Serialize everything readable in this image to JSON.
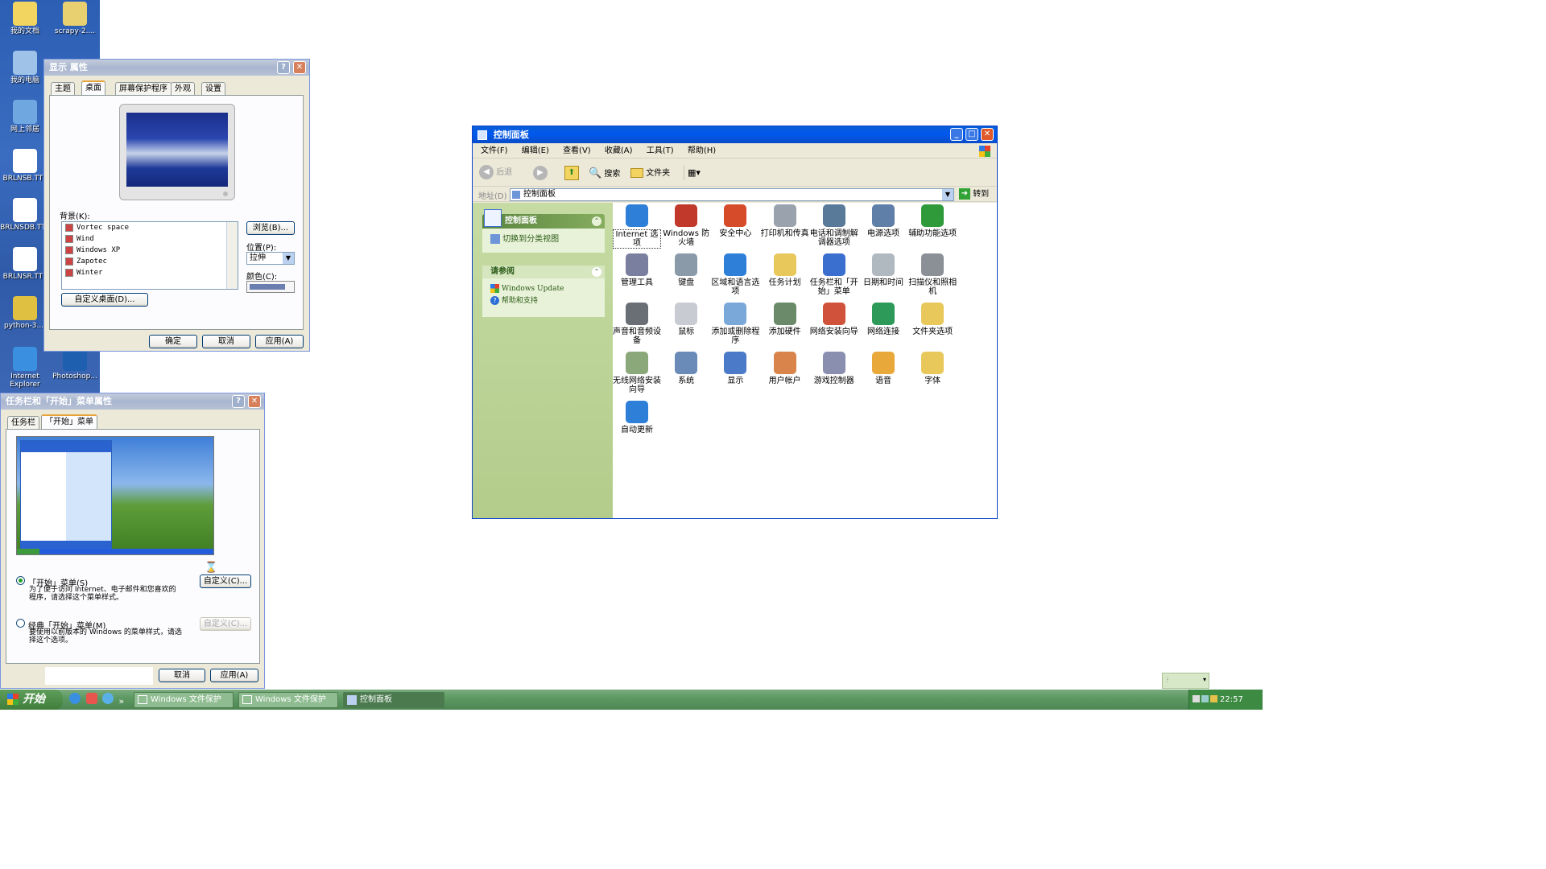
{
  "desktop": {
    "icons": [
      {
        "label": "我的文档",
        "icon": "folder-icon"
      },
      {
        "label": "scrapy-2....",
        "icon": "zip-folder-icon"
      },
      {
        "label": "我的电脑",
        "icon": "computer-icon"
      },
      {
        "label": "网上邻居",
        "icon": "network-icon"
      },
      {
        "label": "BRLNSB.TTF",
        "icon": "font-file-icon"
      },
      {
        "label": "BRLNSDB.TTF",
        "icon": "font-file-icon"
      },
      {
        "label": "BRLNSR.TTF",
        "icon": "font-file-icon"
      },
      {
        "label": "python-3....",
        "icon": "installer-icon"
      },
      {
        "label": "Internet Explorer",
        "icon": "ie-icon"
      },
      {
        "label": "Photoshop...",
        "icon": "photoshop-icon"
      }
    ]
  },
  "display_props": {
    "title": "显示 属性",
    "tabs": [
      "主题",
      "桌面",
      "屏幕保护程序",
      "外观",
      "设置"
    ],
    "background_label": "背景(K):",
    "backgrounds": [
      "Vortec space",
      "Wind",
      "Windows XP",
      "Zapotec",
      "Winter"
    ],
    "browse": "浏览(B)...",
    "position_label": "位置(P):",
    "position_value": "拉伸",
    "color_label": "颜色(C):",
    "customize_desktop": "自定义桌面(D)...",
    "ok": "确定",
    "cancel": "取消",
    "apply": "应用(A)"
  },
  "taskbar_props": {
    "title": "任务栏和「开始」菜单属性",
    "tabs": [
      "任务栏",
      "「开始」菜单"
    ],
    "option1_title": "「开始」菜单(S)",
    "option1_desc": "为了便于访问 Internet、电子邮件和您喜欢的程序，请选择这个菜单样式。",
    "customize": "自定义(C)...",
    "option2_title": "经典「开始」菜单(M)",
    "option2_desc": "要使用以前版本的 Windows 的菜单样式，请选择这个选项。",
    "customize2": "自定义(C)...",
    "cancel": "取消",
    "apply": "应用(A)"
  },
  "control_panel": {
    "title": "控制面板",
    "menu": [
      "文件(F)",
      "编辑(E)",
      "查看(V)",
      "收藏(A)",
      "工具(T)",
      "帮助(H)"
    ],
    "toolbar": {
      "back": "后退",
      "search": "搜索",
      "folders": "文件夹"
    },
    "address_label": "地址(D)",
    "address_value": "控制面板",
    "go": "转到",
    "sidebar": {
      "panel_title": "控制面板",
      "switch_view": "切换到分类视图",
      "see_also_title": "请参阅",
      "links": [
        "Windows Update",
        "帮助和支持"
      ]
    },
    "items": [
      {
        "label": "Internet 选项",
        "icon": "globe-icon"
      },
      {
        "label": "Windows 防火墙",
        "icon": "firewall-icon"
      },
      {
        "label": "安全中心",
        "icon": "shield-icon"
      },
      {
        "label": "打印机和传真",
        "icon": "printer-icon"
      },
      {
        "label": "电话和调制解调器选项",
        "icon": "phone-icon"
      },
      {
        "label": "电源选项",
        "icon": "power-icon"
      },
      {
        "label": "辅助功能选项",
        "icon": "accessibility-icon"
      },
      {
        "label": "管理工具",
        "icon": "tools-icon"
      },
      {
        "label": "键盘",
        "icon": "keyboard-icon"
      },
      {
        "label": "区域和语言选项",
        "icon": "globe-icon"
      },
      {
        "label": "任务计划",
        "icon": "folder-clock-icon"
      },
      {
        "label": "任务栏和「开始」菜单",
        "icon": "taskbar-icon"
      },
      {
        "label": "日期和时间",
        "icon": "clock-icon"
      },
      {
        "label": "扫描仪和照相机",
        "icon": "camera-icon"
      },
      {
        "label": "声音和音频设备",
        "icon": "speaker-icon"
      },
      {
        "label": "鼠标",
        "icon": "mouse-icon"
      },
      {
        "label": "添加或删除程序",
        "icon": "add-remove-icon"
      },
      {
        "label": "添加硬件",
        "icon": "hardware-icon"
      },
      {
        "label": "网络安装向导",
        "icon": "house-icon"
      },
      {
        "label": "网络连接",
        "icon": "network-globe-icon"
      },
      {
        "label": "文件夹选项",
        "icon": "folder-check-icon"
      },
      {
        "label": "无线网络安装向导",
        "icon": "wireless-icon"
      },
      {
        "label": "系统",
        "icon": "system-icon"
      },
      {
        "label": "显示",
        "icon": "display-icon"
      },
      {
        "label": "用户帐户",
        "icon": "users-icon"
      },
      {
        "label": "游戏控制器",
        "icon": "gamepad-icon"
      },
      {
        "label": "语音",
        "icon": "speech-icon"
      },
      {
        "label": "字体",
        "icon": "font-folder-icon"
      },
      {
        "label": "自动更新",
        "icon": "update-icon"
      }
    ]
  },
  "taskbar": {
    "start": "开始",
    "tasks": [
      "Windows 文件保护",
      "Windows 文件保护",
      "控制面板"
    ],
    "clock": "22:57"
  }
}
